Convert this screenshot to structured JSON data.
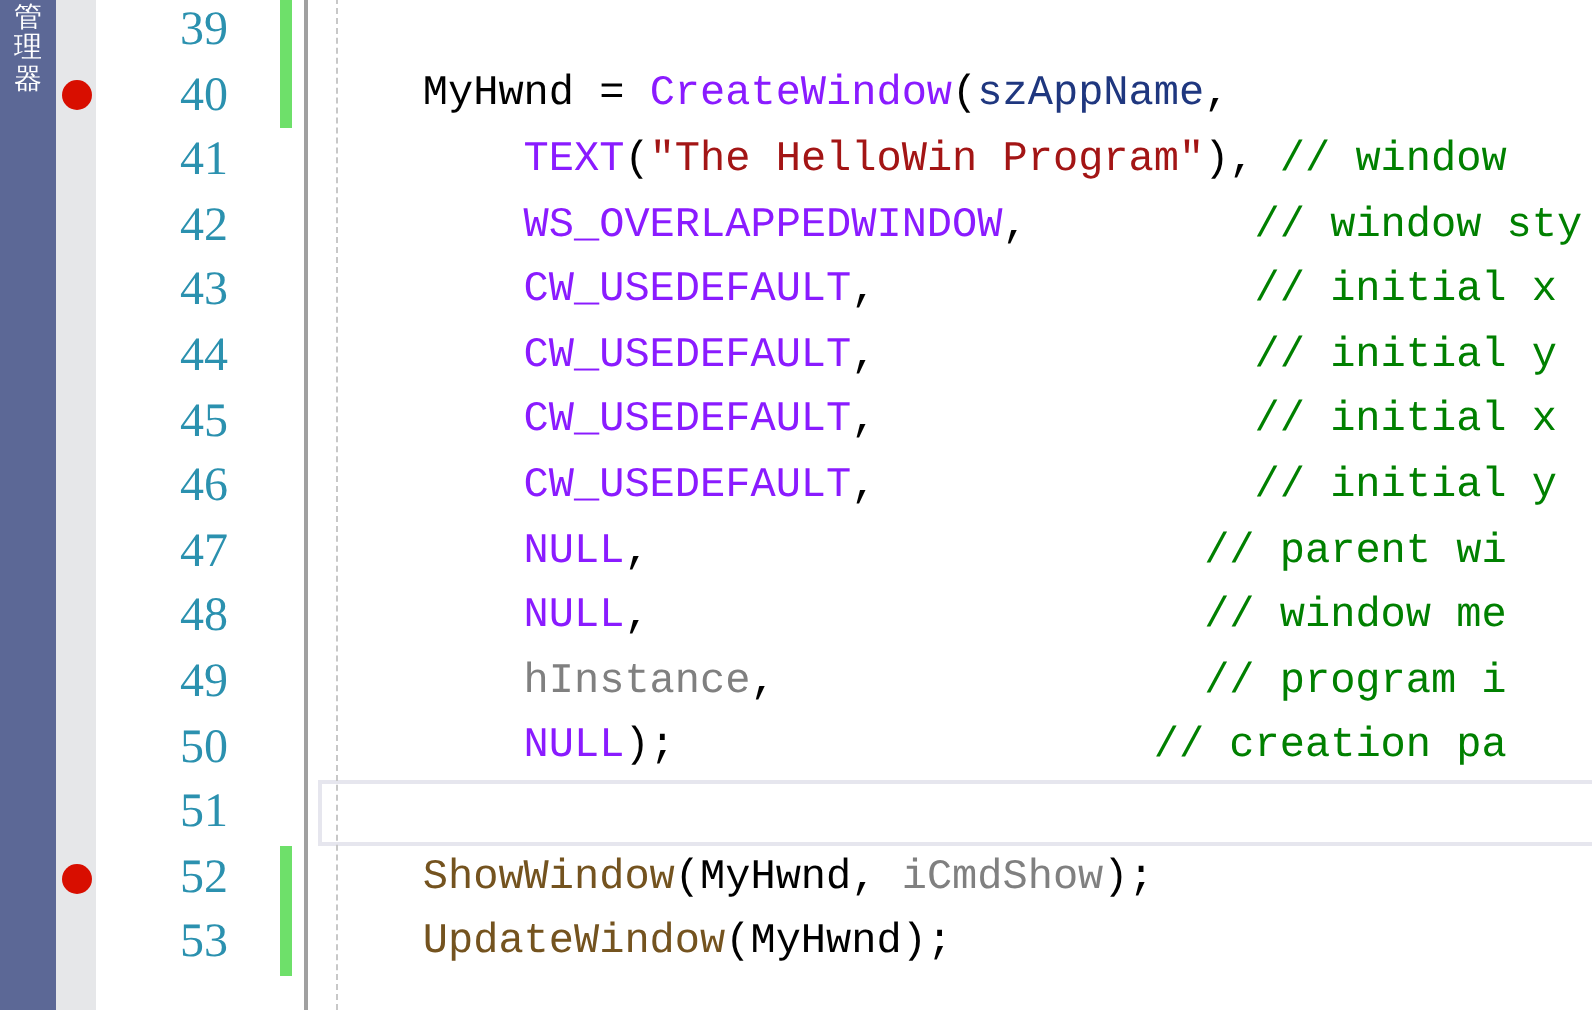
{
  "sidebar": {
    "tab_label": "管理器"
  },
  "lines": [
    {
      "number": "39",
      "breakpoint": false,
      "changed": true,
      "current": false
    },
    {
      "number": "40",
      "breakpoint": true,
      "changed": true,
      "current": false,
      "kind": "statement",
      "tokens": [
        {
          "text": "MyHwnd = ",
          "kind": "plain"
        },
        {
          "text": "CreateWindow",
          "kind": "macro"
        },
        {
          "text": "(",
          "kind": "plain"
        },
        {
          "text": "szAppName",
          "kind": "identifier"
        },
        {
          "text": ",",
          "kind": "plain"
        }
      ]
    },
    {
      "number": "41",
      "breakpoint": false,
      "changed": false,
      "current": false,
      "kind": "continuation",
      "tokens": [
        {
          "text": "TEXT",
          "kind": "macro"
        },
        {
          "text": "(",
          "kind": "plain"
        },
        {
          "text": "\"The HelloWin Program\"",
          "kind": "string"
        },
        {
          "text": "), ",
          "kind": "plain"
        },
        {
          "text": "// window",
          "kind": "comment"
        }
      ]
    },
    {
      "number": "42",
      "breakpoint": false,
      "changed": false,
      "current": false,
      "kind": "continuation",
      "tokens": [
        {
          "text": "WS_OVERLAPPEDWINDOW",
          "kind": "macro"
        },
        {
          "text": ",         ",
          "kind": "plain"
        },
        {
          "text": "// window sty",
          "kind": "comment"
        }
      ]
    },
    {
      "number": "43",
      "breakpoint": false,
      "changed": false,
      "current": false,
      "kind": "continuation",
      "tokens": [
        {
          "text": "CW_USEDEFAULT",
          "kind": "macro"
        },
        {
          "text": ",               ",
          "kind": "plain"
        },
        {
          "text": "// initial x",
          "kind": "comment"
        }
      ]
    },
    {
      "number": "44",
      "breakpoint": false,
      "changed": false,
      "current": false,
      "kind": "continuation",
      "tokens": [
        {
          "text": "CW_USEDEFAULT",
          "kind": "macro"
        },
        {
          "text": ",               ",
          "kind": "plain"
        },
        {
          "text": "// initial y",
          "kind": "comment"
        }
      ]
    },
    {
      "number": "45",
      "breakpoint": false,
      "changed": false,
      "current": false,
      "kind": "continuation",
      "tokens": [
        {
          "text": "CW_USEDEFAULT",
          "kind": "macro"
        },
        {
          "text": ",               ",
          "kind": "plain"
        },
        {
          "text": "// initial x",
          "kind": "comment"
        }
      ]
    },
    {
      "number": "46",
      "breakpoint": false,
      "changed": false,
      "current": false,
      "kind": "continuation",
      "tokens": [
        {
          "text": "CW_USEDEFAULT",
          "kind": "macro"
        },
        {
          "text": ",               ",
          "kind": "plain"
        },
        {
          "text": "// initial y",
          "kind": "comment"
        }
      ]
    },
    {
      "number": "47",
      "breakpoint": false,
      "changed": false,
      "current": false,
      "kind": "continuation",
      "tokens": [
        {
          "text": "NULL",
          "kind": "macro"
        },
        {
          "text": ",                      ",
          "kind": "plain"
        },
        {
          "text": "// parent wi",
          "kind": "comment"
        }
      ]
    },
    {
      "number": "48",
      "breakpoint": false,
      "changed": false,
      "current": false,
      "kind": "continuation",
      "tokens": [
        {
          "text": "NULL",
          "kind": "macro"
        },
        {
          "text": ",                      ",
          "kind": "plain"
        },
        {
          "text": "// window me",
          "kind": "comment"
        }
      ]
    },
    {
      "number": "49",
      "breakpoint": false,
      "changed": false,
      "current": false,
      "kind": "continuation",
      "tokens": [
        {
          "text": "hInstance",
          "kind": "parameter"
        },
        {
          "text": ",                 ",
          "kind": "plain"
        },
        {
          "text": "// program i",
          "kind": "comment"
        }
      ]
    },
    {
      "number": "50",
      "breakpoint": false,
      "changed": false,
      "current": false,
      "kind": "continuation",
      "tokens": [
        {
          "text": "NULL",
          "kind": "macro"
        },
        {
          "text": ");                   ",
          "kind": "plain"
        },
        {
          "text": "// creation pa",
          "kind": "comment"
        }
      ]
    },
    {
      "number": "51",
      "breakpoint": false,
      "changed": false,
      "current": true
    },
    {
      "number": "52",
      "breakpoint": true,
      "changed": true,
      "current": false,
      "kind": "statement",
      "tokens": [
        {
          "text": "ShowWindow",
          "kind": "function"
        },
        {
          "text": "(MyHwnd, ",
          "kind": "plain"
        },
        {
          "text": "iCmdShow",
          "kind": "parameter"
        },
        {
          "text": ");",
          "kind": "plain"
        }
      ]
    },
    {
      "number": "53",
      "breakpoint": false,
      "changed": true,
      "current": false,
      "kind": "statement",
      "tokens": [
        {
          "text": "UpdateWindow",
          "kind": "function"
        },
        {
          "text": "(MyHwnd);",
          "kind": "plain"
        }
      ]
    }
  ]
}
